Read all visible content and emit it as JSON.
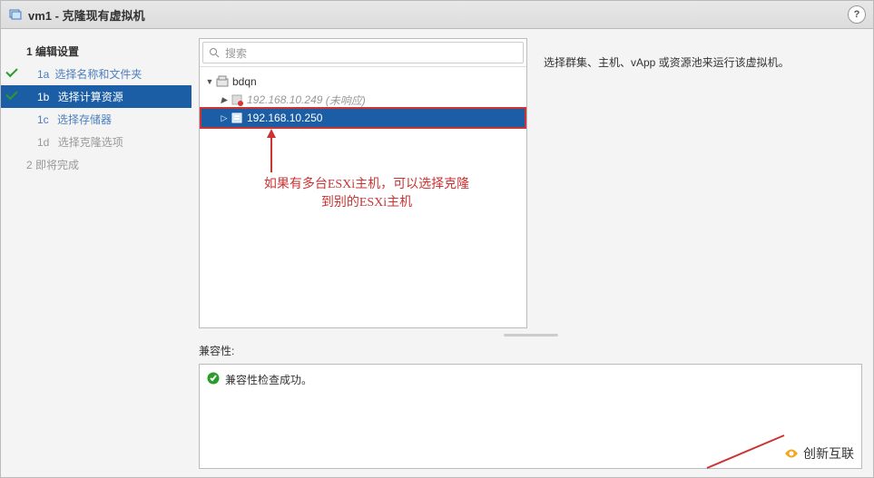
{
  "title": "vm1 - 克隆现有虚拟机",
  "help_icon": "?",
  "sidebar": {
    "items": [
      {
        "num": "1",
        "label": "编辑设置",
        "type": "section"
      },
      {
        "num": "1a",
        "label": "选择名称和文件夹",
        "type": "sub",
        "done": true
      },
      {
        "num": "1b",
        "label": "选择计算资源",
        "type": "sub",
        "active": true,
        "done": true
      },
      {
        "num": "1c",
        "label": "选择存储器",
        "type": "sub"
      },
      {
        "num": "1d",
        "label": "选择克隆选项",
        "type": "sub",
        "dim": true
      },
      {
        "num": "2",
        "label": "即将完成",
        "type": "section",
        "dim": true
      }
    ]
  },
  "search": {
    "placeholder": "搜索"
  },
  "tree": {
    "root": {
      "label": "bdqn"
    },
    "items": [
      {
        "label": "192.168.10.249",
        "suffix": "(未响应)",
        "dim": true
      },
      {
        "label": "192.168.10.250",
        "selected": true
      }
    ]
  },
  "description": "选择群集、主机、vApp 或资源池来运行该虚拟机。",
  "annotation": {
    "line1": "如果有多台ESXi主机，可以选择克隆",
    "line2": "到别的ESXi主机"
  },
  "compat": {
    "label": "兼容性:",
    "message": "兼容性检查成功。"
  },
  "watermark": "创新互联"
}
